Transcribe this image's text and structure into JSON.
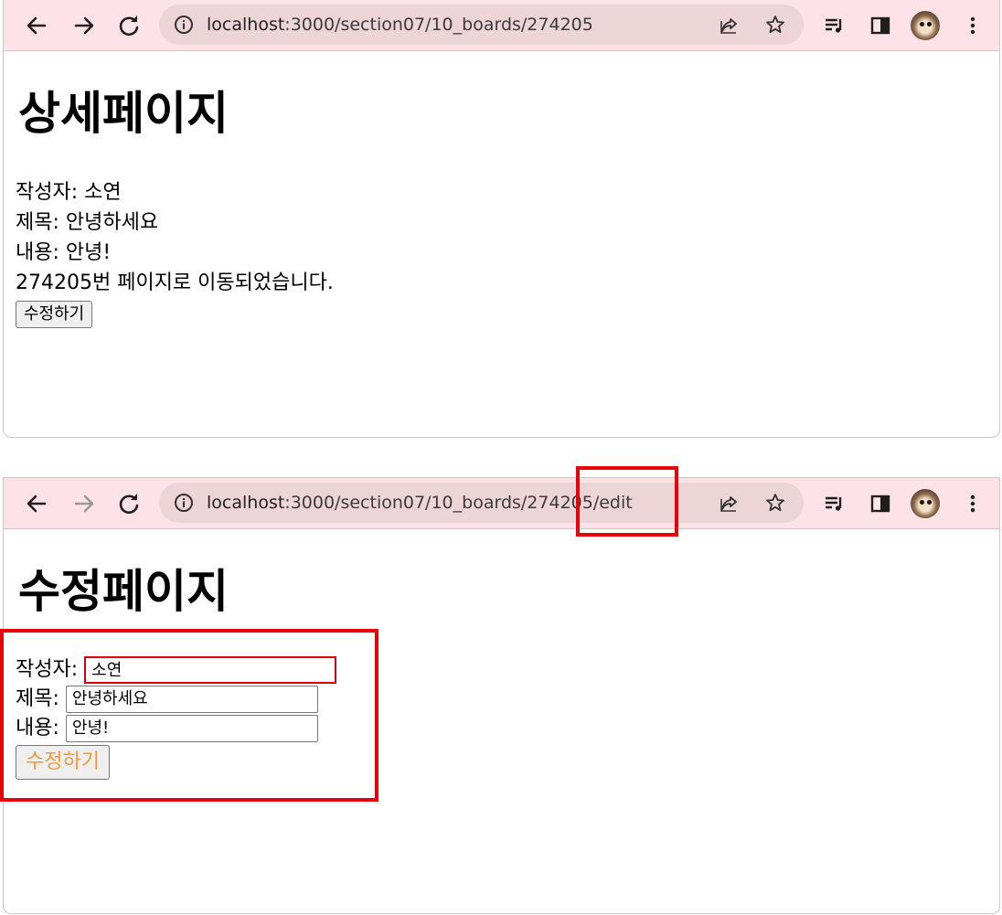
{
  "colors": {
    "toolbar_bg": "#fde3e7",
    "omnibox_bg": "#ecd4d7",
    "highlight": "#e8000a",
    "submit_text": "#f29a3b"
  },
  "icons": {
    "back": "back-arrow-icon",
    "forward": "forward-arrow-icon",
    "reload": "reload-icon",
    "info": "info-icon",
    "share": "share-icon",
    "bookmark": "star-icon",
    "media": "media-queue-icon",
    "side_panel": "side-panel-icon",
    "profile": "profile-avatar",
    "menu": "kebab-menu-icon"
  },
  "detail_window": {
    "url_host": "localhost",
    "url_path": ":3000/section07/10_boards/274205",
    "forward_enabled": true,
    "title": "상세페이지",
    "writer_line": "작성자: 소연",
    "subject_line": "제목: 안녕하세요",
    "contents_line": "내용: 안녕!",
    "moved_line": "274205번 페이지로 이동되었습니다.",
    "edit_button": "수정하기"
  },
  "edit_window": {
    "url_host": "localhost",
    "url_path": ":3000/section07/10_boards/274205/edit",
    "forward_enabled": false,
    "title": "수정페이지",
    "writer_label": "작성자:",
    "writer_value": "소연",
    "subject_label": "제목:",
    "subject_value": "안녕하세요",
    "contents_label": "내용:",
    "contents_value": "안녕!",
    "submit_button": "수정하기"
  }
}
